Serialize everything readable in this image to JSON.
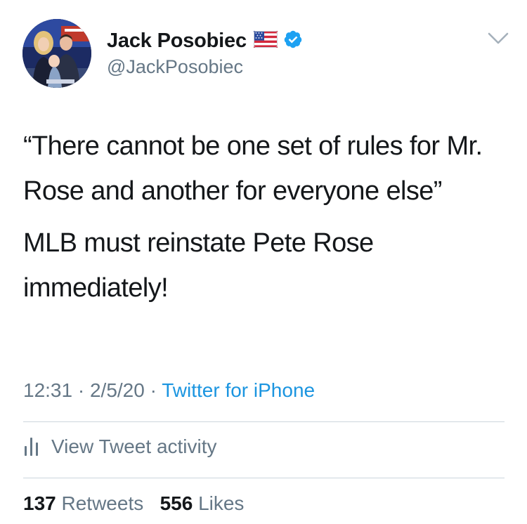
{
  "author": {
    "display_name": "Jack Posobiec",
    "handle": "@JackPosobiec",
    "verified": true,
    "flag_icon": "us-flag-icon",
    "verified_icon": "verified-badge-icon",
    "avatar_icon": "profile-photo"
  },
  "menu_icon": "chevron-down-icon",
  "tweet": {
    "paragraphs": [
      "“There cannot be one set of rules for Mr. Rose and another for everyone else”",
      "MLB must reinstate Pete Rose immediately!"
    ]
  },
  "meta": {
    "time": "12:31",
    "separator": "·",
    "date": "2/5/20",
    "source": "Twitter for iPhone"
  },
  "activity": {
    "label": "View Tweet activity",
    "icon": "bar-chart-icon"
  },
  "stats": {
    "retweets_count": "137",
    "retweets_label": "Retweets",
    "likes_count": "556",
    "likes_label": "Likes"
  },
  "colors": {
    "text_primary": "#14171a",
    "text_secondary": "#657786",
    "link_blue": "#1b95e0",
    "verified_blue": "#1da1f2",
    "divider": "#ccd6dd"
  }
}
